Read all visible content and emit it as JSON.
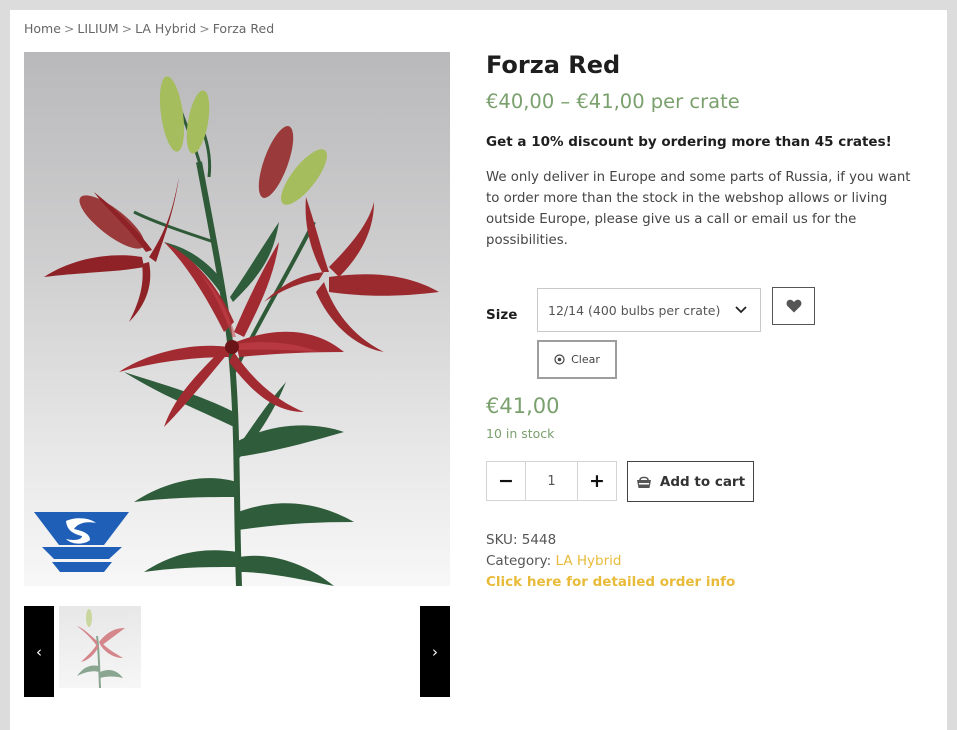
{
  "breadcrumb": {
    "items": [
      "Home",
      "LILIUM",
      "LA Hybrid",
      "Forza Red"
    ],
    "separator": ">"
  },
  "gallery": {
    "main_image_alt": "red lily icon",
    "logo_icon": "vs-logo-icon",
    "prev_label": "‹",
    "next_label": "›"
  },
  "product": {
    "title": "Forza Red",
    "price_range": "€40,00 – €41,00 per crate",
    "discount_text": "Get a 10% discount by ordering more than 45 crates!",
    "description": "We only deliver in Europe and some parts of Russia, if you want to order more than the stock in the webshop allows or living outside Europe, please give us a call or email us for the possibilities."
  },
  "variation": {
    "size_label": "Size",
    "selected_size": "12/14 (400 bulbs per crate)",
    "clear_label": "Clear",
    "wishlist_icon": "heart-icon"
  },
  "purchase": {
    "price": "€41,00",
    "stock": "10 in stock",
    "quantity": "1",
    "minus_label": "−",
    "plus_label": "+",
    "add_to_cart_label": "Add to cart",
    "cart_icon": "basket-icon"
  },
  "meta": {
    "sku_label": "SKU:",
    "sku_value": "5448",
    "category_label": "Category:",
    "category_value": "LA Hybrid",
    "order_info_link": "Click here for detailed order info"
  },
  "colors": {
    "price_green": "#7aa06d",
    "link_yellow": "#e8bb3a",
    "title": "#1e1e1e",
    "logo_blue": "#1f5fb8"
  }
}
